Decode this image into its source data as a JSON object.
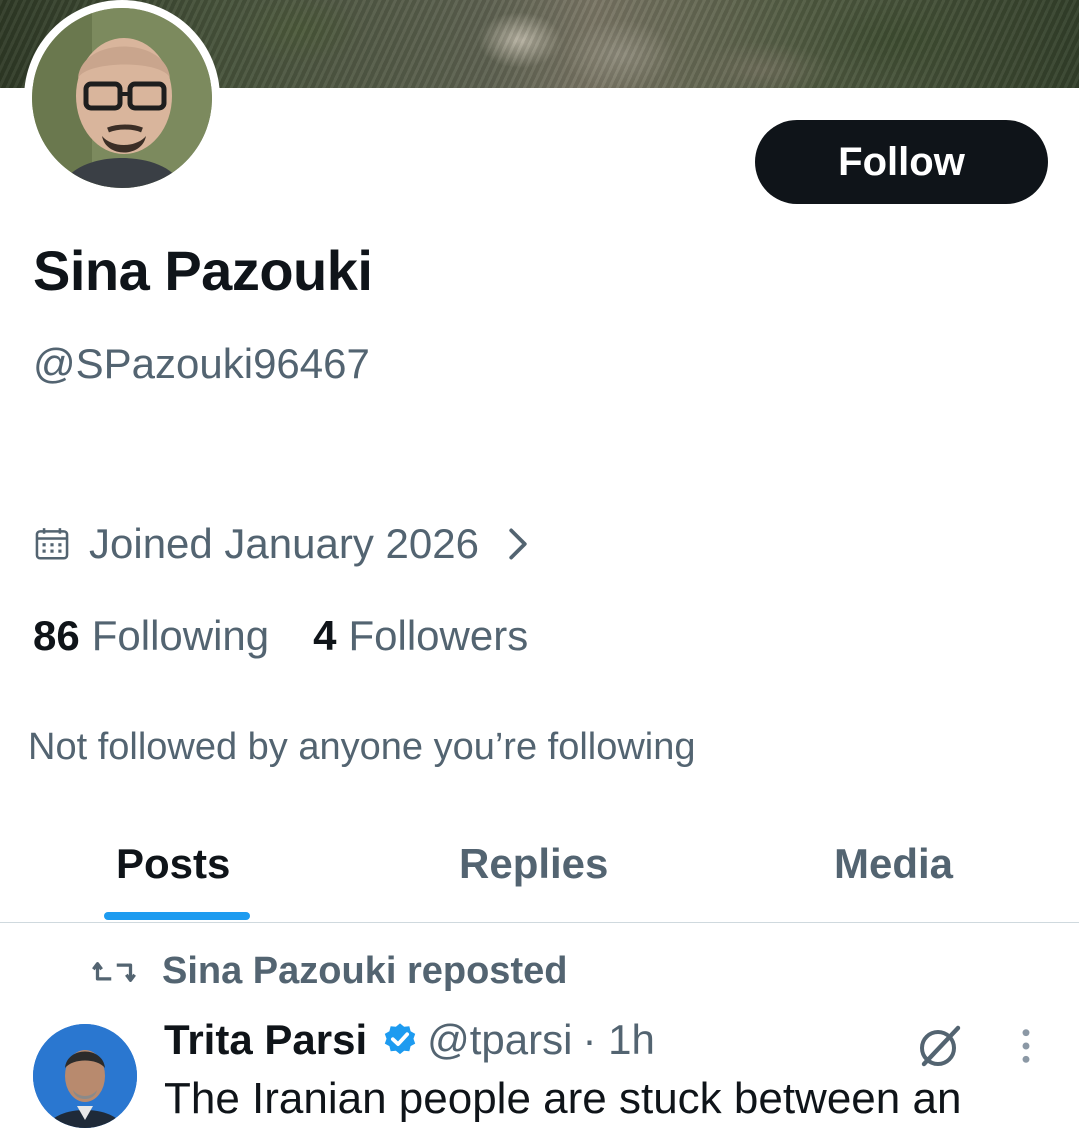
{
  "profile": {
    "display_name": "Sina Pazouki",
    "handle": "@SPazouki96467",
    "follow_label": "Follow",
    "joined": "Joined January 2026",
    "following_count": "86",
    "following_label": "Following",
    "followers_count": "4",
    "followers_label": "Followers",
    "not_followed": "Not followed by anyone you’re following"
  },
  "tabs": [
    {
      "label": "Posts",
      "active": true
    },
    {
      "label": "Replies",
      "active": false
    },
    {
      "label": "Media",
      "active": false
    }
  ],
  "post": {
    "repost_text": "Sina Pazouki reposted",
    "author_name": "Trita Parsi",
    "author_handle": "@tparsi",
    "time": "· 1h",
    "text": "The Iranian people are stuck between an"
  },
  "colors": {
    "accent": "#1d9bf0",
    "text_primary": "#0f1419",
    "text_secondary": "#536471",
    "follow_button_bg": "#0f1419"
  },
  "icons": [
    "calendar-icon",
    "chevron-right-icon",
    "repost-icon",
    "verified-badge-icon",
    "grok-icon",
    "more-icon"
  ]
}
